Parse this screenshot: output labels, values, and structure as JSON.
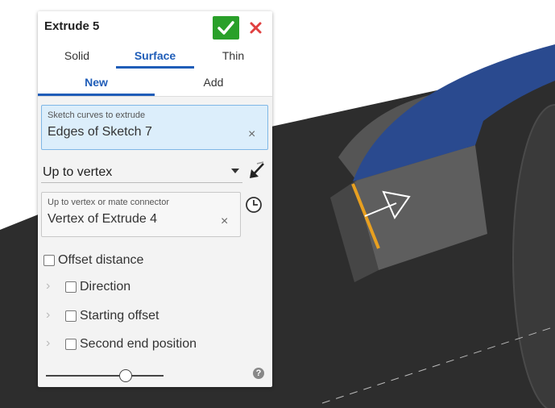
{
  "dialog": {
    "title": "Extrude 5",
    "type_tabs": [
      {
        "label": "Solid",
        "active": false
      },
      {
        "label": "Surface",
        "active": true
      },
      {
        "label": "Thin",
        "active": false
      }
    ],
    "mode_tabs": [
      {
        "label": "New",
        "active": true
      },
      {
        "label": "Add",
        "active": false
      }
    ],
    "sketch_field": {
      "label": "Sketch curves to extrude",
      "value": "Edges of Sketch 7",
      "clear": "×"
    },
    "end_type": {
      "selected": "Up to vertex"
    },
    "vertex_field": {
      "label": "Up to vertex or mate connector",
      "value": "Vertex of Extrude 4",
      "clear": "×"
    },
    "offset_distance": {
      "label": "Offset distance",
      "checked": false
    },
    "direction": {
      "label": "Direction",
      "checked": false
    },
    "starting_offset": {
      "label": "Starting offset",
      "checked": false
    },
    "second_end": {
      "label": "Second end position",
      "checked": false
    },
    "slider": {
      "level": 0.68
    },
    "help": "?"
  },
  "colors": {
    "accent": "#1f5db8",
    "ok": "#2aa02a",
    "cancel": "#e04040",
    "model_dark": "#2c2c2c",
    "surface_blue": "#2a4a8f",
    "edge_orange": "#e8a020"
  },
  "icons": {
    "ok": "checkmark-icon",
    "cancel": "close-icon",
    "flip": "flip-direction-icon",
    "mate": "mate-connector-icon",
    "help": "help-icon"
  }
}
